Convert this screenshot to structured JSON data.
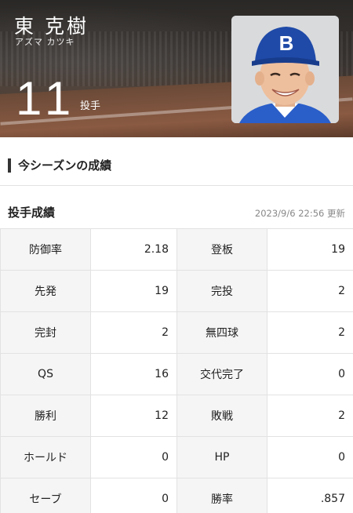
{
  "player": {
    "name": "東 克樹",
    "kana": "アズマ カツキ",
    "number": "11",
    "position": "投手"
  },
  "section": {
    "title": "今シーズンの成績"
  },
  "pitching": {
    "title": "投手成績",
    "updated": "2023/9/6 22:56 更新",
    "rows": [
      [
        {
          "label": "防御率",
          "value": "2.18"
        },
        {
          "label": "登板",
          "value": "19"
        }
      ],
      [
        {
          "label": "先発",
          "value": "19"
        },
        {
          "label": "完投",
          "value": "2"
        }
      ],
      [
        {
          "label": "完封",
          "value": "2"
        },
        {
          "label": "無四球",
          "value": "2"
        }
      ],
      [
        {
          "label": "QS",
          "value": "16"
        },
        {
          "label": "交代完了",
          "value": "0"
        }
      ],
      [
        {
          "label": "勝利",
          "value": "12"
        },
        {
          "label": "敗戦",
          "value": "2"
        }
      ],
      [
        {
          "label": "ホールド",
          "value": "0"
        },
        {
          "label": "HP",
          "value": "0"
        }
      ],
      [
        {
          "label": "セーブ",
          "value": "0"
        },
        {
          "label": "勝率",
          "value": ".857"
        }
      ]
    ]
  },
  "colors": {
    "cap": "#1f4aa8",
    "jersey": "#2a5ec9"
  }
}
